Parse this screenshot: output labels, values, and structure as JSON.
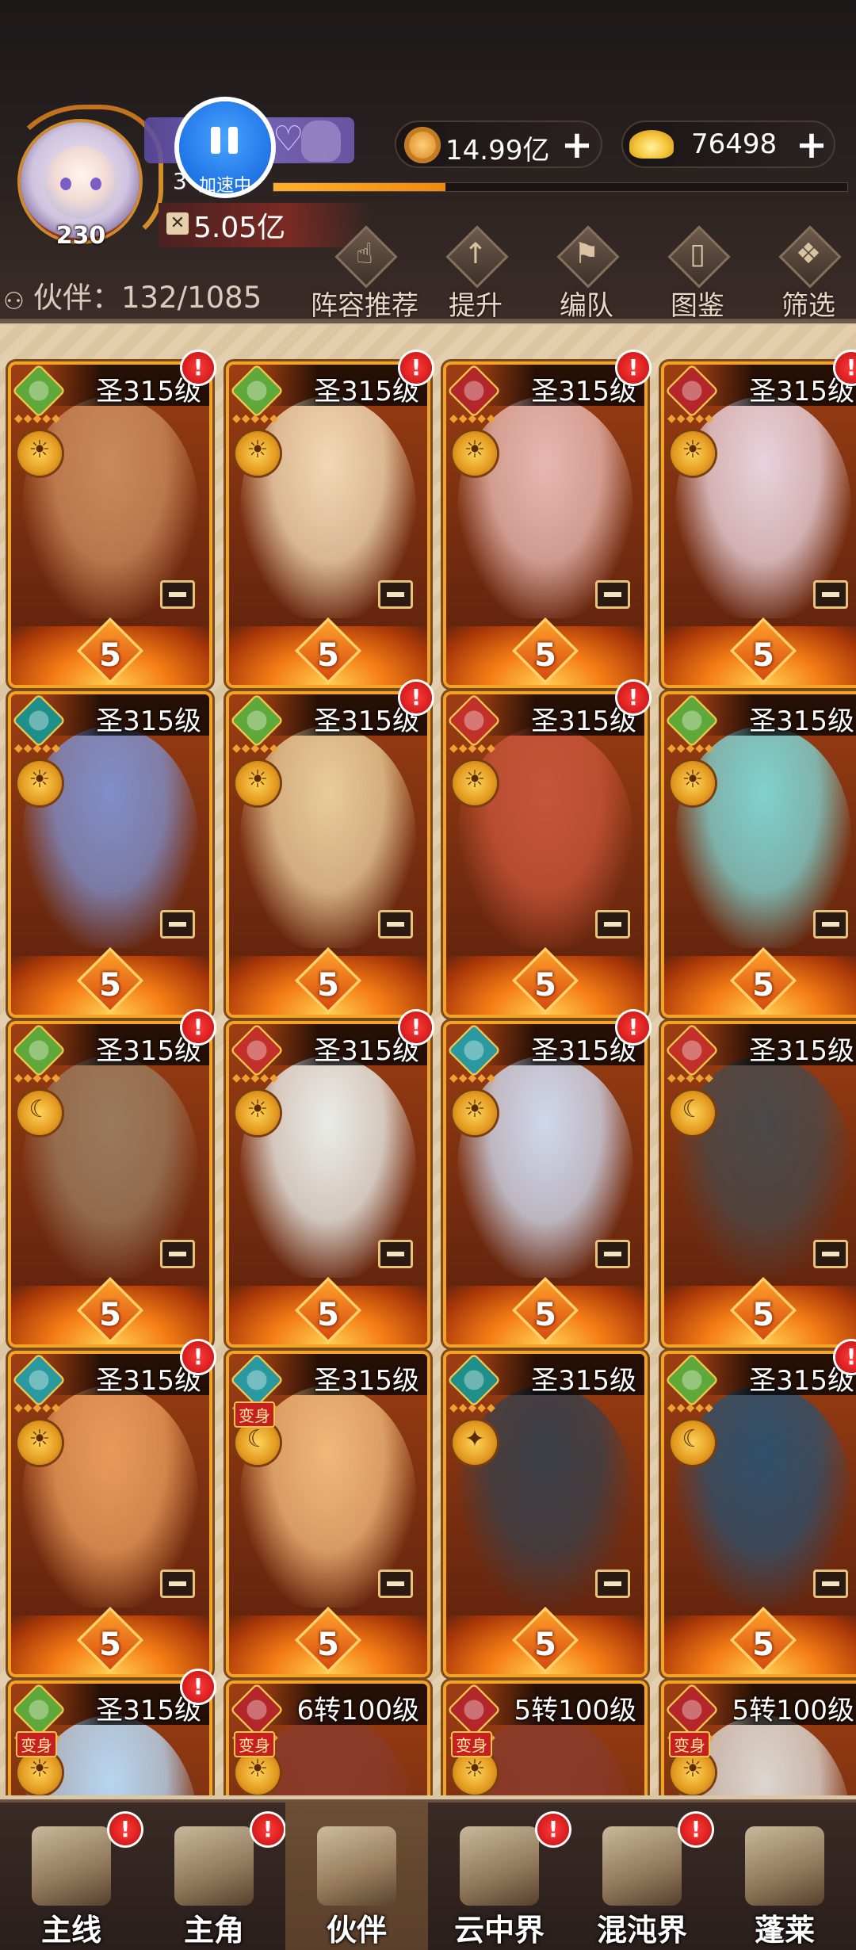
{
  "header": {
    "player_level": "230",
    "exp_prefix": "3",
    "exp_fraction": 0.3,
    "pause_label": "加速中",
    "power": "5.05亿",
    "coins": "14.99亿",
    "ingots": "76498",
    "partner_count": "伙伴：132/1085"
  },
  "top_menu": [
    {
      "label": "阵容推荐",
      "icon": "recommend-icon"
    },
    {
      "label": "提升",
      "icon": "upgrade-icon"
    },
    {
      "label": "编队",
      "icon": "formation-icon"
    },
    {
      "label": "图鉴",
      "icon": "codex-icon"
    },
    {
      "label": "筛选",
      "icon": "filter-icon"
    }
  ],
  "cards": [
    {
      "level": "圣315级",
      "stars": "5",
      "alert": "!",
      "faction": "green-leaf",
      "role": "sun",
      "art": "#c98a5c"
    },
    {
      "level": "圣315级",
      "stars": "5",
      "alert": "!",
      "faction": "green-leaf",
      "role": "sun",
      "art": "#f1d9b3"
    },
    {
      "level": "圣315级",
      "stars": "5",
      "alert": "!",
      "faction": "red-demon",
      "role": "sun",
      "art": "#e7b7b0"
    },
    {
      "level": "圣315级",
      "stars": "5",
      "alert": "!",
      "faction": "red-demon",
      "role": "sun",
      "art": "#e9d2dc"
    },
    {
      "level": "圣315级",
      "stars": "5",
      "alert": "",
      "faction": "teal-ghost",
      "role": "sun",
      "art": "#7f8ec9"
    },
    {
      "level": "圣315级",
      "stars": "5",
      "alert": "!",
      "faction": "green-leaf",
      "role": "sun",
      "art": "#e8cc9a"
    },
    {
      "level": "圣315级",
      "stars": "5",
      "alert": "!",
      "faction": "red-fox",
      "role": "sun",
      "art": "#c7543a"
    },
    {
      "level": "圣315级",
      "stars": "5",
      "alert": "",
      "faction": "green-leaf",
      "role": "sun",
      "art": "#7fd1cf"
    },
    {
      "level": "圣315级",
      "stars": "5",
      "alert": "!",
      "faction": "green-leaf",
      "role": "moon",
      "art": "#9a7a5c"
    },
    {
      "level": "圣315级",
      "stars": "5",
      "alert": "!",
      "faction": "red-fox",
      "role": "sun",
      "art": "#e9ece8"
    },
    {
      "level": "圣315级",
      "stars": "5",
      "alert": "!",
      "faction": "teal-bird",
      "role": "sun",
      "art": "#cfd8ec"
    },
    {
      "level": "圣315级",
      "stars": "5",
      "alert": "",
      "faction": "red-fox",
      "role": "moon",
      "art": "#4a4848"
    },
    {
      "level": "圣315级",
      "stars": "5",
      "alert": "!",
      "faction": "teal-bird",
      "role": "sun",
      "art": "#e99a5a",
      "transform": ""
    },
    {
      "level": "圣315级",
      "stars": "5",
      "alert": "",
      "faction": "teal-bird",
      "role": "moon",
      "art": "#f0b879",
      "transform": "变身"
    },
    {
      "level": "圣315级",
      "stars": "5",
      "alert": "",
      "faction": "teal-ghost",
      "role": "star",
      "art": "#3b3f48"
    },
    {
      "level": "圣315级",
      "stars": "5",
      "alert": "!",
      "faction": "green-leaf",
      "role": "moon",
      "art": "#2f4f6a"
    },
    {
      "level": "圣315级",
      "stars": "",
      "alert": "!",
      "faction": "green-leaf",
      "role": "sun",
      "art": "#b7d6f0",
      "transform": "变身"
    },
    {
      "level": "6转100级",
      "stars": "",
      "alert": "",
      "faction": "red-demon",
      "role": "sun",
      "art": "#8a3a2a",
      "transform": "变身"
    },
    {
      "level": "5转100级",
      "stars": "",
      "alert": "",
      "faction": "red-demon",
      "role": "sun",
      "art": "#8a3a2a",
      "transform": "变身"
    },
    {
      "level": "5转100级",
      "stars": "",
      "alert": "",
      "faction": "red-demon",
      "role": "sun",
      "art": "#dcd6d0",
      "transform": "变身"
    }
  ],
  "bottom_nav": [
    {
      "label": "主线",
      "alert": "!",
      "active": false
    },
    {
      "label": "主角",
      "alert": "!",
      "active": false
    },
    {
      "label": "伙伴",
      "alert": "",
      "active": true
    },
    {
      "label": "云中界",
      "alert": "!",
      "active": false
    },
    {
      "label": "混沌界",
      "alert": "!",
      "active": false
    },
    {
      "label": "蓬莱",
      "alert": "",
      "active": false
    }
  ],
  "colors": {
    "green-leaf": "#5fa83a",
    "red-demon": "#b3262a",
    "red-fox": "#c2302a",
    "teal-ghost": "#1f8f8a",
    "teal-bird": "#2a9aa0"
  }
}
